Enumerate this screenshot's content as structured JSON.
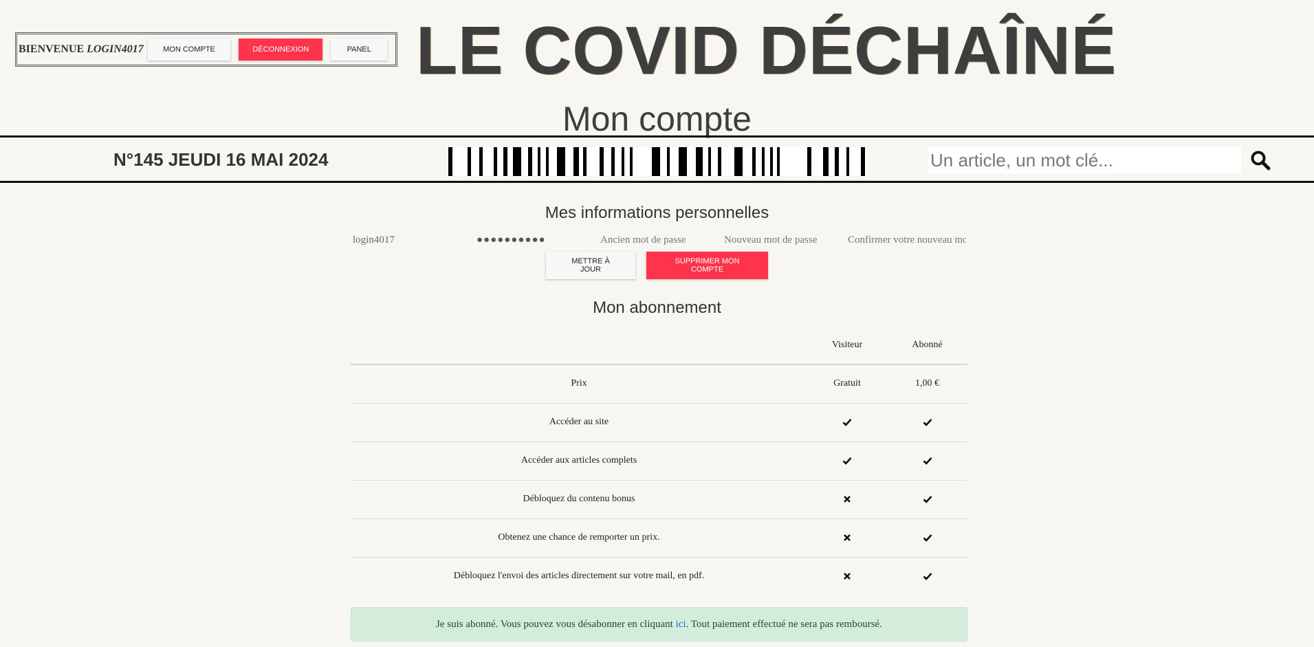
{
  "header": {
    "welcome_prefix": "BIENVENUE",
    "username": "LOGIN4017",
    "account_button": "MON COMPTE",
    "logout_button": "DÉCONNEXION",
    "panel_button": "PANEL",
    "masthead": "LE COVID DÉCHAÎNÉ"
  },
  "page_title": "Mon compte",
  "infobar": {
    "issue": "N°145 JEUDI 16 MAI 2024",
    "search_placeholder": "Un article, un mot clé..."
  },
  "personal": {
    "title": "Mes informations personnelles",
    "login_value": "login4017",
    "password_mask": "●●●●●●●●●●",
    "old_password_placeholder": "Ancien mot de passe",
    "new_password_placeholder": "Nouveau mot de passe",
    "confirm_placeholder": "Confirmer votre nouveau mot de passe",
    "update_button": "METTRE À JOUR",
    "delete_button": "SUPPRIMER MON COMPTE"
  },
  "subscription": {
    "title": "Mon abonnement",
    "columns": [
      "",
      "Visiteur",
      "Abonné"
    ],
    "rows": [
      {
        "feature": "Prix",
        "visitor": "Gratuit",
        "subscriber": "1,00 €"
      },
      {
        "feature": "Accéder au site",
        "visitor": "check",
        "subscriber": "check"
      },
      {
        "feature": "Accéder aux articles complets",
        "visitor": "check",
        "subscriber": "check"
      },
      {
        "feature": "Débloquez du contenu bonus",
        "visitor": "cross",
        "subscriber": "check"
      },
      {
        "feature": "Obtenez une chance de remporter un prix.",
        "visitor": "cross",
        "subscriber": "check"
      },
      {
        "feature": "Débloquez l'envoi des articles directement sur votre mail, en pdf.",
        "visitor": "cross",
        "subscriber": "check"
      }
    ],
    "alert_before": "Je suis abonné. Vous pouvez vous désabonner en cliquant ",
    "alert_link": "ici",
    "alert_after": ". Tout paiement effectué ne sera pas remboursé."
  },
  "colors": {
    "accent_red": "#ff334b",
    "background": "#f8f6f1",
    "alert_bg": "#d4ecdb"
  }
}
